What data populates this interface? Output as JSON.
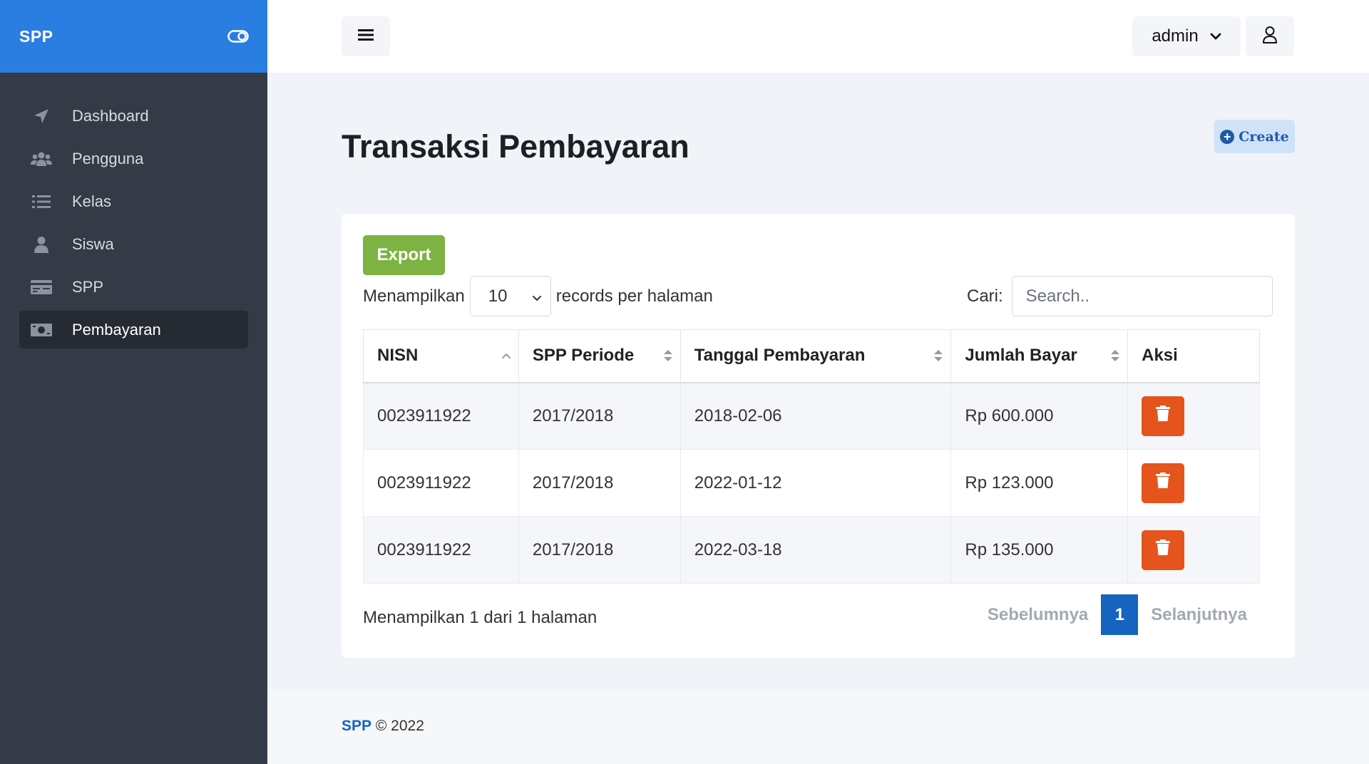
{
  "sidebar": {
    "brand": "SPP",
    "items": [
      {
        "label": "Dashboard",
        "icon": "paper-plane-icon"
      },
      {
        "label": "Pengguna",
        "icon": "users-icon"
      },
      {
        "label": "Kelas",
        "icon": "list-icon"
      },
      {
        "label": "Siswa",
        "icon": "user-icon"
      },
      {
        "label": "SPP",
        "icon": "card-icon"
      },
      {
        "label": "Pembayaran",
        "icon": "money-icon",
        "active": true
      }
    ]
  },
  "topbar": {
    "user_label": "admin"
  },
  "page": {
    "title": "Transaksi Pembayaran",
    "create_label": "Create"
  },
  "table_controls": {
    "export_label": "Export",
    "show_prefix": "Menampilkan",
    "page_size": "10",
    "show_suffix": "records per halaman",
    "search_label": "Cari:",
    "search_placeholder": "Search.."
  },
  "table": {
    "columns": [
      "NISN",
      "SPP Periode",
      "Tanggal Pembayaran",
      "Jumlah Bayar",
      "Aksi"
    ],
    "rows": [
      {
        "nisn": "0023911922",
        "periode": "2017/2018",
        "tanggal": "2018-02-06",
        "jumlah": "Rp 600.000"
      },
      {
        "nisn": "0023911922",
        "periode": "2017/2018",
        "tanggal": "2022-01-12",
        "jumlah": "Rp 123.000"
      },
      {
        "nisn": "0023911922",
        "periode": "2017/2018",
        "tanggal": "2022-03-18",
        "jumlah": "Rp 135.000"
      }
    ]
  },
  "pagination": {
    "info": "Menampilkan 1 dari 1 halaman",
    "prev": "Sebelumnya",
    "current": "1",
    "next": "Selanjutnya"
  },
  "footer": {
    "brand": "SPP",
    "text": "© 2022"
  },
  "colors": {
    "brand": "#2a7de1",
    "sidebar": "#343a46",
    "export": "#7cb342",
    "delete": "#e5541c",
    "page_active": "#1565c0"
  }
}
